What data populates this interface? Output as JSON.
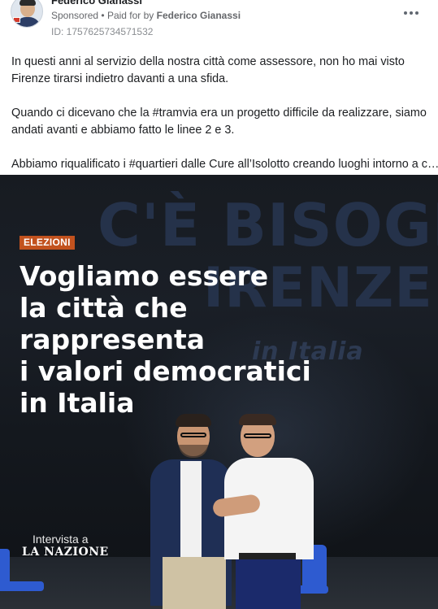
{
  "post": {
    "author": "Federico Gianassi",
    "sponsored_label": "Sponsored",
    "separator": "•",
    "paid_for_prefix": "Paid for by",
    "paid_for_name": "Federico Gianassi",
    "ad_id": "ID: 1757625734571532",
    "more_options_icon": "more-horizontal-icon",
    "text": {
      "p1_line1": "In questi anni al servizio della nostra città come assessore, non ho mai visto",
      "p1_line2": "Firenze tirarsi indietro davanti a una sfida.",
      "p2_line1_a": "Quando ci dicevano che la ",
      "p2_line1_tag": "#tramvia",
      "p2_line1_b": " era un progetto difficile da realizzare, siamo",
      "p2_line2": "andati avanti e abbiamo fatto le linee 2 e 3.",
      "p3_line1_a": "Abbiamo riqualificato i ",
      "p3_line1_tag": "#quartieri",
      "p3_line1_b": " dalle Cure all’Isolotto creando luoghi intorno a c…"
    }
  },
  "creative": {
    "background_text_1": "C'È BISOGNO",
    "background_text_2": "IRENZE",
    "background_text_3": "in Italia",
    "tag": "ELEZIONI",
    "headline": [
      "Vogliamo essere",
      "la città che",
      "rappresenta",
      "i valori democratici",
      "in Italia"
    ],
    "interview_label": "Intervista a",
    "publication": "LA NAZIONE"
  },
  "colors": {
    "tag_bg": "#c2521e",
    "headline": "#ffffff",
    "chair": "#2e5bd0"
  }
}
